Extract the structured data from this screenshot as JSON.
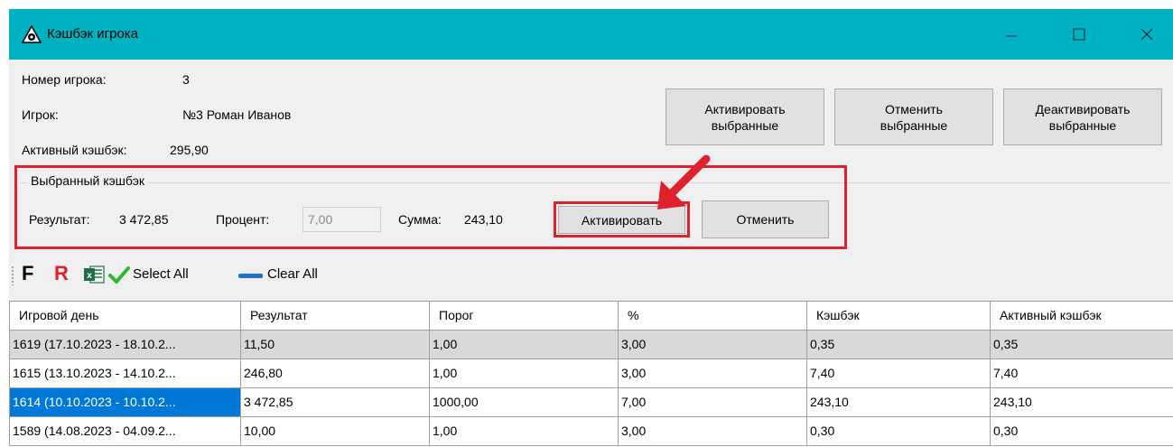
{
  "window": {
    "title": "Кэшбэк игрока",
    "controls": [
      "minimize",
      "maximize",
      "close"
    ]
  },
  "player": {
    "number_label": "Номер игрока:",
    "number_value": "3",
    "name_label": "Игрок:",
    "name_value": "№3 Роман Иванов",
    "active_label": "Активный кэшбэк:",
    "active_value": "295,90"
  },
  "actions": {
    "activate_selected_line1": "Активировать",
    "activate_selected_line2": "выбранные",
    "cancel_selected_line1": "Отменить",
    "cancel_selected_line2": "выбранные",
    "deactivate_selected_line1": "Деактивировать",
    "deactivate_selected_line2": "выбранные"
  },
  "selected": {
    "group_title": "Выбранный кэшбэк",
    "result_label": "Результат:",
    "result_value": "3 472,85",
    "percent_label": "Процент:",
    "percent_value": "7,00",
    "sum_label": "Сумма:",
    "sum_value": "243,10",
    "activate_label": "Активировать",
    "cancel_label": "Отменить"
  },
  "toolbar": {
    "f_label": "F",
    "r_label": "R",
    "select_all": "Select All",
    "clear_all": "Clear All"
  },
  "table": {
    "columns": [
      "Игровой день",
      "Результат",
      "Порог",
      "%",
      "Кэшбэк",
      "Активный кэшбэк"
    ],
    "rows": [
      [
        "1619 (17.10.2023 - 18.10.2...",
        "11,50",
        "1,00",
        "3,00",
        "0,35",
        "0,35"
      ],
      [
        "1615 (13.10.2023 - 14.10.2...",
        "246,80",
        "1,00",
        "3,00",
        "7,40",
        "7,40"
      ],
      [
        "1614 (10.10.2023 - 10.10.2...",
        "3 472,85",
        "1000,00",
        "7,00",
        "243,10",
        "243,10"
      ],
      [
        "1589 (14.08.2023 - 04.09.2...",
        "10,00",
        "1,00",
        "3,00",
        "0,30",
        "0,30"
      ]
    ]
  },
  "colors": {
    "titlebar": "#00b1c1",
    "highlight": "#e0202c",
    "selected_cell": "#0078d7"
  }
}
